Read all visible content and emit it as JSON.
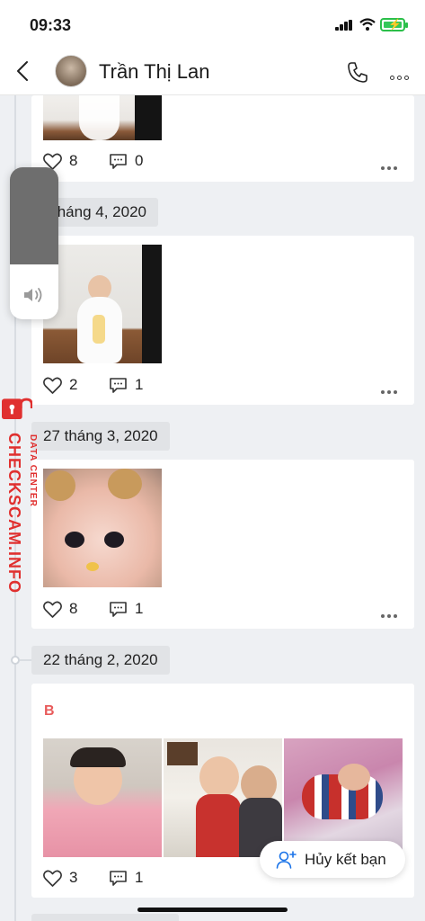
{
  "status_bar": {
    "time": "09:33"
  },
  "header": {
    "contact_name": "Trần Thị Lan"
  },
  "posts": [
    {
      "likes": "8",
      "comments": "0"
    },
    {
      "date": "tháng 4, 2020",
      "likes": "2",
      "comments": "1"
    },
    {
      "date": "27 tháng 3, 2020",
      "likes": "8",
      "comments": "1"
    },
    {
      "date": "22 tháng 2, 2020",
      "caption": "B",
      "likes": "3",
      "comments": "1"
    }
  ],
  "volume": {
    "level": 0.64
  },
  "watermark": {
    "main": "CHECKSCAM.INFO",
    "sub": "DATA CENTER"
  },
  "unfriend_button": {
    "label": "Hủy kết bạn"
  },
  "colors": {
    "accent": "#1a73e8",
    "badge": "#e85b5b",
    "watermark": "#e0302f"
  }
}
